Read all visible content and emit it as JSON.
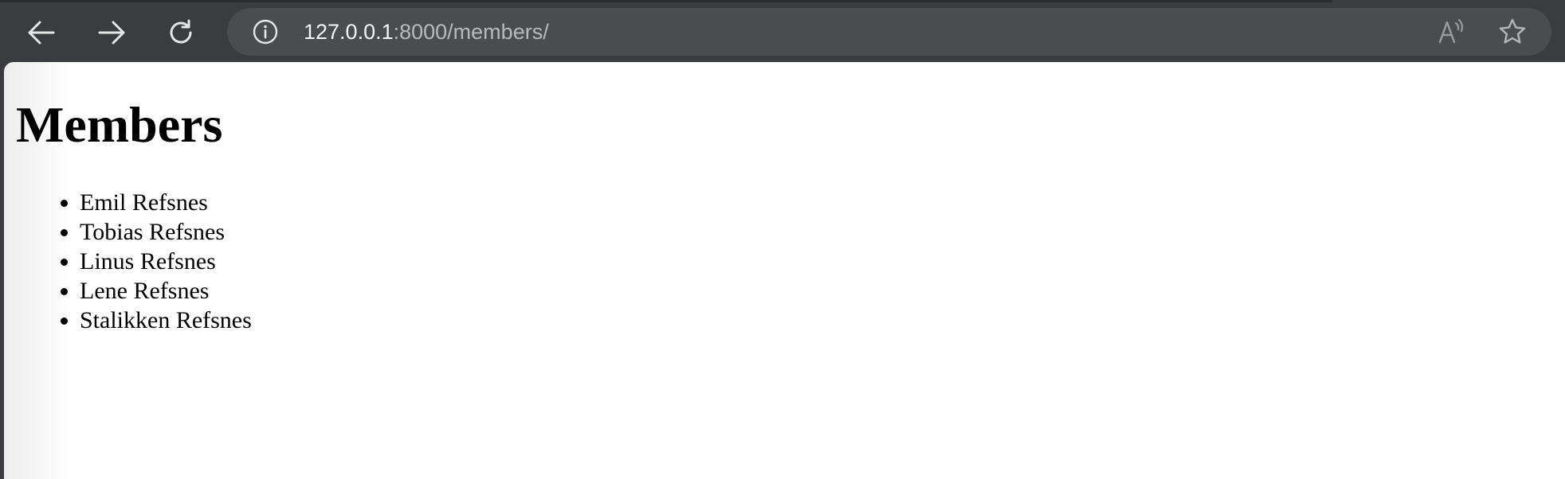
{
  "browser": {
    "toolbar": {
      "back_icon": "arrow-left-icon",
      "forward_icon": "arrow-right-icon",
      "reload_icon": "reload-icon"
    },
    "address_bar": {
      "info_icon": "info-icon",
      "url_host": "127.0.0.1",
      "url_path": ":8000/members/",
      "read_aloud_icon": "read-aloud-icon",
      "favorite_icon": "star-icon"
    },
    "colors": {
      "chrome": "#3b3c3f",
      "address_bar": "#4b4c50",
      "url_host": "#f3f3f4",
      "url_path": "#b8b9bb"
    }
  },
  "page": {
    "title": "Members",
    "members": [
      "Emil Refsnes",
      "Tobias Refsnes",
      "Linus Refsnes",
      "Lene Refsnes",
      "Stalikken Refsnes"
    ]
  }
}
